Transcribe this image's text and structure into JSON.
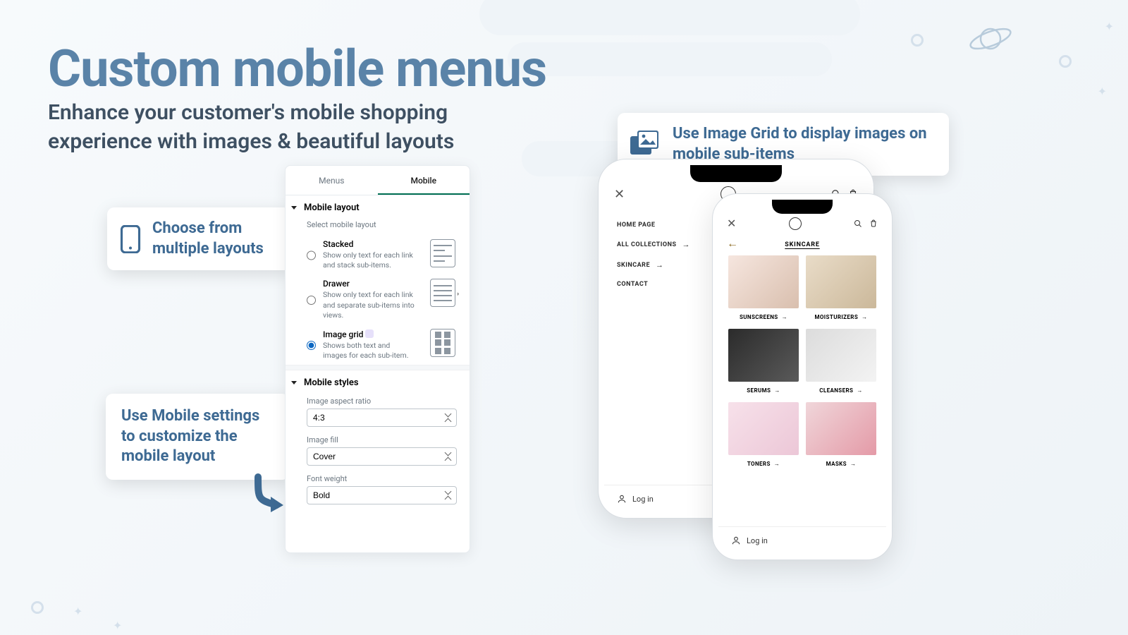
{
  "hero": {
    "title": "Custom mobile menus",
    "subtitle": "Enhance your customer's mobile shopping experience with images & beautiful layouts"
  },
  "callouts": {
    "layouts": "Choose from multiple layouts",
    "settings": "Use Mobile settings to customize the mobile layout",
    "image_grid": "Use Image Grid to display images on mobile sub-items"
  },
  "panel": {
    "tabs": {
      "menus": "Menus",
      "mobile": "Mobile"
    },
    "sections": {
      "layout_header": "Mobile layout",
      "layout_select_label": "Select mobile layout",
      "options": [
        {
          "title": "Stacked",
          "desc": "Show only text for each link and stack sub-items.",
          "selected": false,
          "icon": "stacked"
        },
        {
          "title": "Drawer",
          "desc": "Show only text for each link and separate sub-items into views.",
          "selected": false,
          "icon": "drawer"
        },
        {
          "title": "Image grid",
          "desc": "Shows both text and images for each sub-item.",
          "selected": true,
          "icon": "grid"
        }
      ],
      "styles_header": "Mobile styles",
      "fields": {
        "aspect_label": "Image aspect ratio",
        "aspect_value": "4:3",
        "fill_label": "Image fill",
        "fill_value": "Cover",
        "weight_label": "Font weight",
        "weight_value": "Bold"
      }
    }
  },
  "phone_drawer": {
    "items": [
      "HOME PAGE",
      "ALL COLLECTIONS",
      "SKINCARE",
      "CONTACT"
    ],
    "login": "Log in"
  },
  "phone_grid": {
    "title": "SKINCARE",
    "login": "Log in",
    "cells": [
      {
        "label": "SUNSCREENS",
        "color1": "#f6e6df",
        "color2": "#d9bfae"
      },
      {
        "label": "MOISTURIZERS",
        "color1": "#e9dcc8",
        "color2": "#cbb89a"
      },
      {
        "label": "SERUMS",
        "color1": "#2b2b2b",
        "color2": "#5a5a5a"
      },
      {
        "label": "CLEANSERS",
        "color1": "#dcdcdc",
        "color2": "#f3f3f3"
      },
      {
        "label": "TONERS",
        "color1": "#f7e1ea",
        "color2": "#ecc7d7"
      },
      {
        "label": "MASKS",
        "color1": "#f0d6da",
        "color2": "#e49aa7"
      }
    ]
  }
}
